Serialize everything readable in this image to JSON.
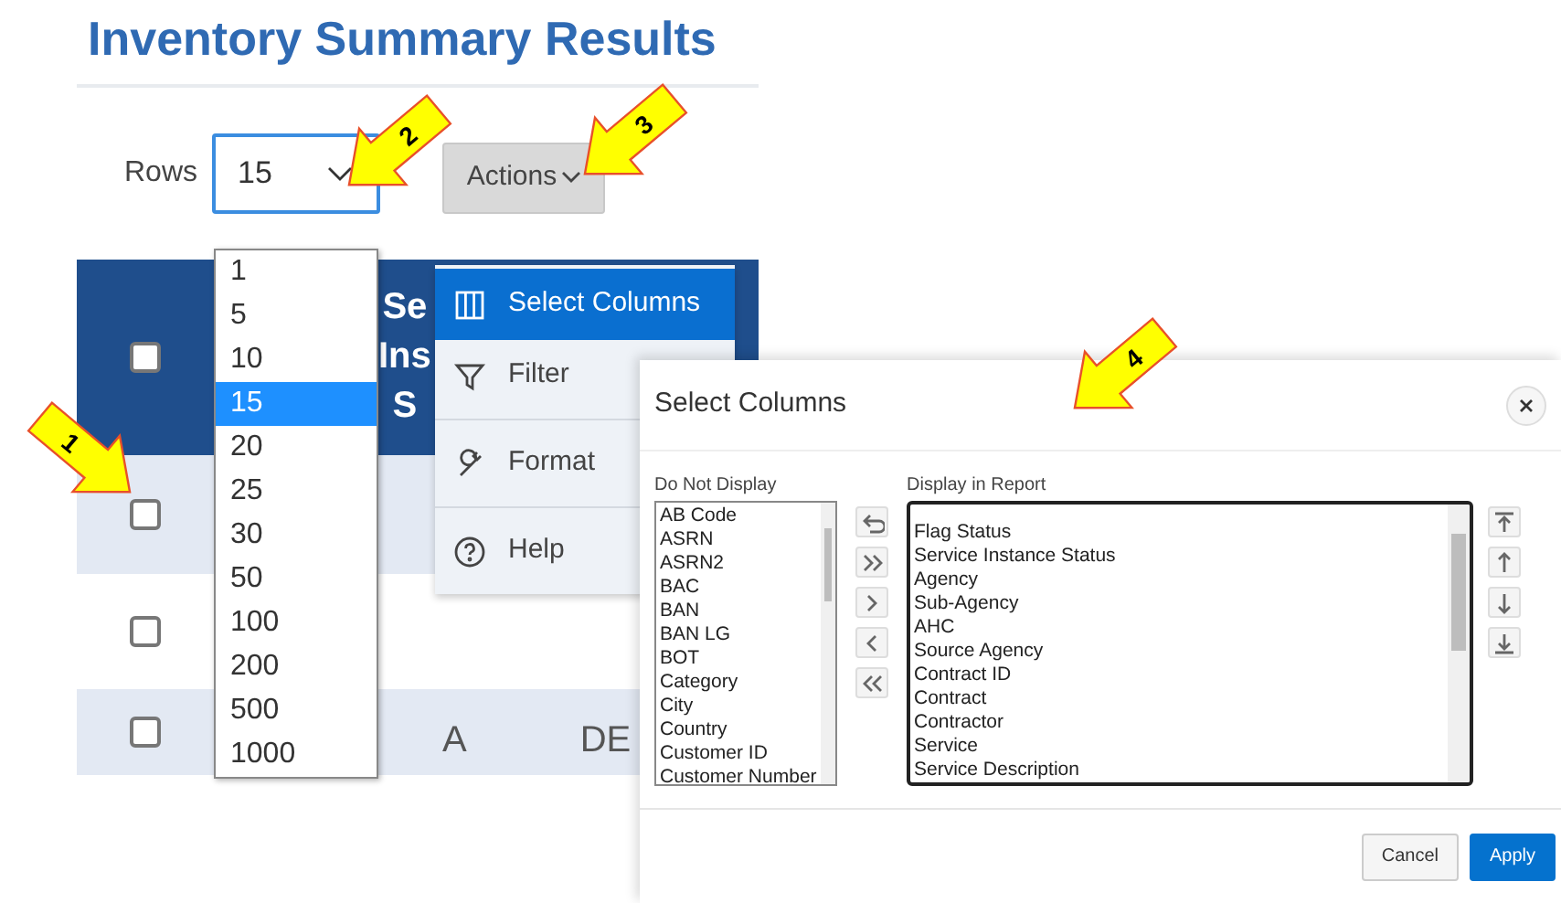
{
  "page_title": "Inventory Summary Results",
  "toolbar": {
    "rows_label": "Rows",
    "rows_value": "15",
    "actions_label": "Actions"
  },
  "table": {
    "select_all": {
      "checked": false
    },
    "header_text": [
      "Se",
      "Ins",
      "S"
    ],
    "rows": [
      {
        "checked": false
      },
      {
        "checked": false
      },
      {
        "checked": false,
        "cells": [
          "A",
          "DE"
        ]
      }
    ]
  },
  "rows_options": [
    {
      "label": "1",
      "selected": false
    },
    {
      "label": "5",
      "selected": false
    },
    {
      "label": "10",
      "selected": false
    },
    {
      "label": "15",
      "selected": true
    },
    {
      "label": "20",
      "selected": false
    },
    {
      "label": "25",
      "selected": false
    },
    {
      "label": "30",
      "selected": false
    },
    {
      "label": "50",
      "selected": false
    },
    {
      "label": "100",
      "selected": false
    },
    {
      "label": "200",
      "selected": false
    },
    {
      "label": "500",
      "selected": false
    },
    {
      "label": "1000",
      "selected": false
    }
  ],
  "actions_menu": [
    {
      "label": "Select Columns",
      "kind": "columns",
      "selected": true
    },
    {
      "label": "Filter",
      "kind": "filter",
      "selected": false
    },
    {
      "label": "Format",
      "kind": "format",
      "selected": false
    },
    {
      "label": "Help",
      "kind": "help",
      "selected": false
    }
  ],
  "dialog": {
    "title": "Select Columns",
    "available_label": "Do Not Display",
    "available": [
      "AB Code",
      "ASRN",
      "ASRN2",
      "BAC",
      "BAN",
      "BAN LG",
      "BOT",
      "Category",
      "City",
      "Country",
      "Customer ID",
      "Customer Number"
    ],
    "selected_label": "Display in Report",
    "selected_columns": [
      "Flag Status",
      "Service Instance Status",
      "Agency",
      "Sub-Agency",
      "AHC",
      "Source Agency",
      "Contract ID",
      "Contract",
      "Contractor",
      "Service",
      "Service Description"
    ],
    "buttons": [
      {
        "label": "Cancel",
        "kind": "secondary"
      },
      {
        "label": "Apply",
        "kind": "primary"
      }
    ]
  },
  "callouts": [
    {
      "number": "1"
    },
    {
      "number": "2"
    },
    {
      "number": "3"
    },
    {
      "number": "4"
    }
  ]
}
